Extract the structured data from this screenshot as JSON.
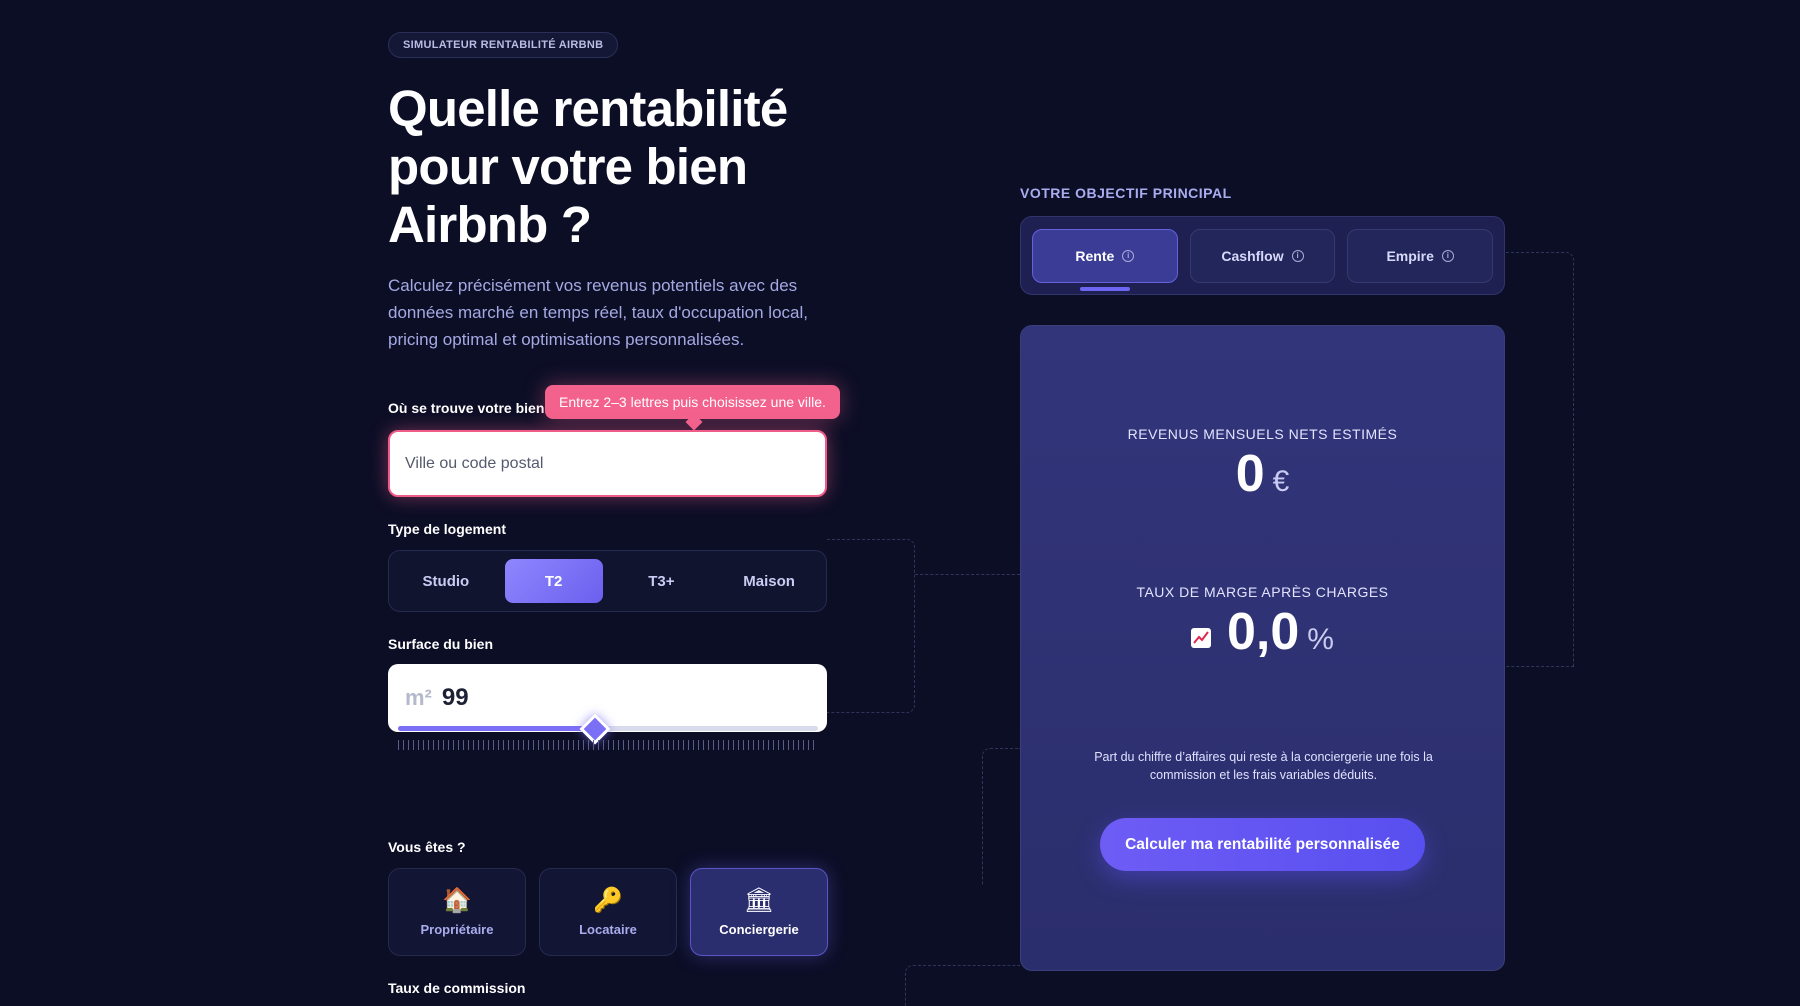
{
  "badge": "SIMULATEUR RENTABILITÉ AIRBNB",
  "hero": {
    "title": "Quelle rentabilité pour votre bien Airbnb ?",
    "subtitle": "Calculez précisément vos revenus potentiels avec des données marché en temps réel, taux d'occupation local, pricing optimal et optimisations personnalisées."
  },
  "location": {
    "label": "Où se trouve votre bien ?",
    "tooltip": "Entrez 2–3 lettres puis choisissez une ville.",
    "placeholder": "Ville ou code postal",
    "value": ""
  },
  "housing": {
    "label": "Type de logement",
    "options": [
      "Studio",
      "T2",
      "T3+",
      "Maison"
    ],
    "selected": "T2"
  },
  "surface": {
    "label": "Surface du bien",
    "unit": "m²",
    "value": "99",
    "slider_fraction": 0.47
  },
  "profile": {
    "label": "Vous êtes ?",
    "options": [
      {
        "label": "Propriétaire",
        "icon": "house-icon"
      },
      {
        "label": "Locataire",
        "icon": "key-icon"
      },
      {
        "label": "Conciergerie",
        "icon": "building-icon"
      }
    ],
    "selected": "Conciergerie"
  },
  "commission": {
    "label": "Taux de commission"
  },
  "objective": {
    "title": "VOTRE OBJECTIF PRINCIPAL",
    "tabs": [
      "Rente",
      "Cashflow",
      "Empire"
    ],
    "selected": "Rente"
  },
  "results": {
    "revenue_label": "REVENUS MENSUELS NETS ESTIMÉS",
    "revenue_value": "0",
    "revenue_unit": "€",
    "margin_label": "TAUX DE MARGE APRÈS CHARGES",
    "margin_value": "0,0",
    "margin_unit": "%",
    "description": "Part du chiffre d’affaires qui reste à la conciergerie une fois la commission et les frais variables déduits.",
    "cta": "Calculer ma rentabilité personnalisée"
  },
  "colors": {
    "background": "#0c0e26",
    "accent": "#6d66f3",
    "tooltip": "#f3618d"
  }
}
